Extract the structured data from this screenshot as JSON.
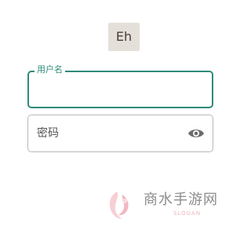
{
  "app": {
    "logo_text": "Eh"
  },
  "login_form": {
    "username_label": "用户名",
    "username_value": "",
    "password_placeholder": "密码",
    "password_value": ""
  },
  "icons": {
    "password_visibility": "eye-icon"
  },
  "watermark": {
    "brand": "商水手游网",
    "sub": "SLOGAN"
  },
  "colors": {
    "accent": "#2f8a7a",
    "logo_background": "#e4e0d9",
    "logo_text": "#4a3b36",
    "border_idle": "#b8b8b8",
    "watermark_pink": "#f0b4bd"
  }
}
